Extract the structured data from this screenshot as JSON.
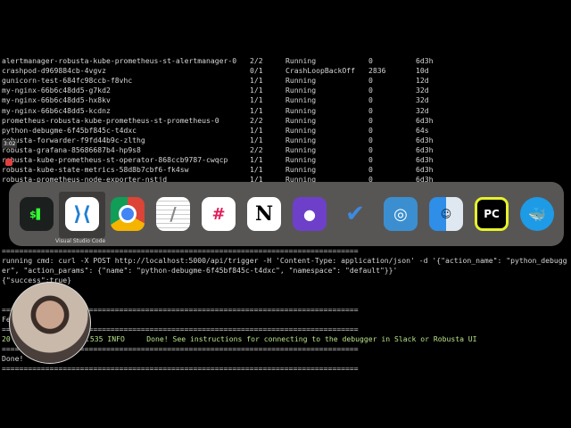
{
  "pods": [
    {
      "name": "alertmanager-robusta-kube-prometheus-st-alertmanager-0",
      "ready": "2/2",
      "status": "Running",
      "restarts": "0",
      "age": "6d3h"
    },
    {
      "name": "crashpod-d969884cb-4vgvz",
      "ready": "0/1",
      "status": "CrashLoopBackOff",
      "restarts": "2836",
      "age": "10d"
    },
    {
      "name": "gunicorn-test-684fc98ccb-f8vhc",
      "ready": "1/1",
      "status": "Running",
      "restarts": "0",
      "age": "12d"
    },
    {
      "name": "my-nginx-66b6c48dd5-g7kd2",
      "ready": "1/1",
      "status": "Running",
      "restarts": "0",
      "age": "32d"
    },
    {
      "name": "my-nginx-66b6c48dd5-hx8kv",
      "ready": "1/1",
      "status": "Running",
      "restarts": "0",
      "age": "32d"
    },
    {
      "name": "my-nginx-66b6c48dd5-kcdnz",
      "ready": "1/1",
      "status": "Running",
      "restarts": "0",
      "age": "32d"
    },
    {
      "name": "prometheus-robusta-kube-prometheus-st-prometheus-0",
      "ready": "2/2",
      "status": "Running",
      "restarts": "0",
      "age": "6d3h"
    },
    {
      "name": "python-debugme-6f45bf845c-t4dxc",
      "ready": "1/1",
      "status": "Running",
      "restarts": "0",
      "age": "64s"
    },
    {
      "name": "robusta-forwarder-f9fd44b9c-zlthg",
      "ready": "1/1",
      "status": "Running",
      "restarts": "0",
      "age": "6d3h"
    },
    {
      "name": "robusta-grafana-85686687b4-hp9s8",
      "ready": "2/2",
      "status": "Running",
      "restarts": "0",
      "age": "6d3h"
    },
    {
      "name": "robusta-kube-prometheus-st-operator-868ccb9787-cwqcp",
      "ready": "1/1",
      "status": "Running",
      "restarts": "0",
      "age": "6d3h"
    },
    {
      "name": "robusta-kube-state-metrics-58d8b7cbf6-fk4sw",
      "ready": "1/1",
      "status": "Running",
      "restarts": "0",
      "age": "6d3h"
    },
    {
      "name": "robusta-prometheus-node-exporter-nstjd",
      "ready": "1/1",
      "status": "Running",
      "restarts": "0",
      "age": "6d3h"
    }
  ],
  "output": {
    "sep": "==================================================================================",
    "cmd1": "running cmd: curl -X POST http://localhost:5000/api/trigger -H 'Content-Type: application/json' -d '{\"action_name\": \"python_debugg",
    "cmd2": "er\", \"action_params\": {\"name\": \"python-debugme-6f45bf845c-t4dxc\", \"namespace\": \"default\"}}'",
    "result": "{\"success\":true}",
    "fe": "Fe",
    "log_prefix": "20",
    "log": ".535 INFO     Done! See instructions for connecting to the debugger in Slack or Robusta UI",
    "done": "Done!"
  },
  "recording": {
    "time": "3:02"
  },
  "dock": {
    "hover_label": "Visual Studio Code",
    "apps": [
      "Terminal",
      "Visual Studio Code",
      "Google Chrome",
      "TextEdit",
      "Slack",
      "Notion",
      "GitHub Desktop",
      "Microsoft To Do",
      "Screenshot Utility",
      "Finder",
      "PyCharm",
      "Docker"
    ]
  }
}
